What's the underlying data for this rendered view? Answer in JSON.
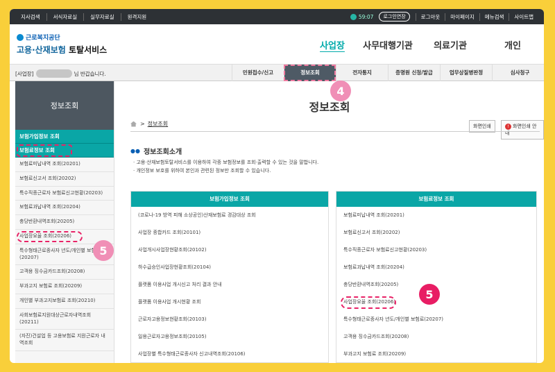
{
  "topbar": {
    "links": [
      "지사검색",
      "서식자료실",
      "실무자료실",
      "원격지원"
    ],
    "timer": "59:07",
    "extend": "로그인연장",
    "right_links": [
      "로그아웃",
      "마이페이지",
      "메뉴검색",
      "사이트맵"
    ]
  },
  "header": {
    "org": "근로복지공단",
    "title_a": "고용·산재보험",
    "title_b": "토탈서비스",
    "nav": [
      "사업장",
      "사무대행기관",
      "의료기관",
      "개인"
    ]
  },
  "subbar": {
    "welcome_prefix": "[사업장]",
    "welcome_suffix": "님 반갑습니다.",
    "menu": [
      "민원접수/신고",
      "정보조회",
      "전자통지",
      "증명원 신청/발급",
      "업무상질병판정",
      "심사청구"
    ]
  },
  "sidebar": {
    "heading": "정보조회",
    "categories": [
      "보험가입정보 조회",
      "보험료정보 조회"
    ],
    "items": [
      "보험료미납내역 조회(20201)",
      "보험료신고서 조회(20202)",
      "특수직종근로자 보험료신고현황(20203)",
      "보험료과납내역 조회(20204)",
      "충당반환내역조회(20205)",
      "사업장요율 조회(20206)",
      "특수형태근로종사자 년도/개인별 보험료(20207)",
      "고객용 징수금카드조회(20208)",
      "부과고지 보험료 조회(20209)",
      "개인별 부과고지보험료 조회(20210)",
      "사회보험료지원대상근로자내역조회(20211)",
      "(자진)건설업 등 고용보험료 지원근로자 내역조회"
    ]
  },
  "badges": {
    "four": "4",
    "five": "5"
  },
  "content": {
    "title": "정보조회",
    "breadcrumb": "정보조회",
    "print": "화면인쇄",
    "print_guide": "화면인쇄 안내",
    "intro_title": "정보조회소개",
    "intro_lines": [
      "· 고용·산재보험토탈서비스를 이용하여 각종 보험정보를 조회·출력할 수 있는 것을 말합니다.",
      "· 개인정보 보호를 위하여 본인과 관련된 정보만 조회할 수 있습니다."
    ],
    "left_panel": {
      "title": "보험가입정보 조회",
      "rows": [
        "(코로나-19 방역 피해 소상공인)산재보험료 경감대상 조회",
        "사업장 종합카드 조회(20101)",
        "사업개시사업장현황조회(20102)",
        "하수급승인사업장현황조회(20104)",
        "플랫폼 이용사업 개시신고 처리 결과 안내",
        "플랫폼 이용사업 개시현황 조회",
        "근로자고용정보현황조회(20103)",
        "일용근로자고용정보조회(20105)",
        "사업장별 특수형태근로종사자 신고내역조회(20106)"
      ]
    },
    "right_panel": {
      "title": "보험료정보 조회",
      "rows": [
        "보험료미납내역 조회(20201)",
        "보험료신고서 조회(20202)",
        "특수직종근로자 보험료신고현황(20203)",
        "보험료과납내역 조회(20204)",
        "충당반환내역조회(20205)",
        "사업장요율 조회(20206)",
        "특수형태근로종사자 년도/개인별 보험료(20207)",
        "고객용 징수금카드조회(20208)",
        "부과고지 보험료 조회(20209)"
      ]
    }
  }
}
